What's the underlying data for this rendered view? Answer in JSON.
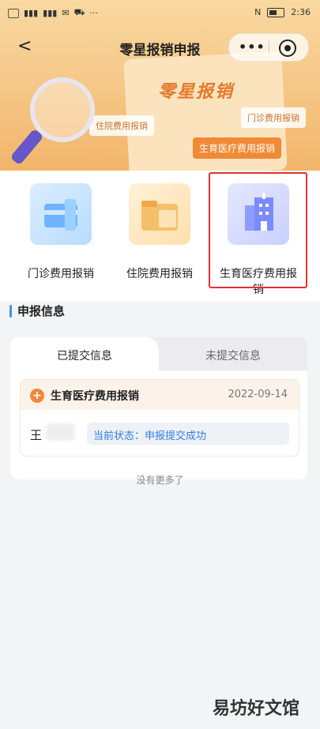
{
  "status_bar": {
    "time": "2:36",
    "left_icons": [
      "hd-icon",
      "signal-icon",
      "signal-icon",
      "app-icon",
      "app-icon",
      "cart-icon",
      "browser-icon"
    ],
    "more_glyph": "···"
  },
  "nav": {
    "back_glyph": "<",
    "title": "零星报销申报",
    "more_glyph": "•••"
  },
  "banner": {
    "title": "零星报销",
    "tags": [
      "住院费用报销",
      "门诊费用报销",
      "生育医疗费用报销"
    ],
    "colors": {
      "top": "#f8d9a0",
      "bottom": "#f2b56a"
    }
  },
  "services": [
    {
      "label": "门诊费用报销",
      "icon": "outpatient-card-icon",
      "color": "#6fb4ff"
    },
    {
      "label": "住院费用报销",
      "icon": "folder-icon",
      "color": "#f5c06a"
    },
    {
      "label": "生育医疗费用报销",
      "icon": "hospital-icon",
      "color": "#7a8bff"
    }
  ],
  "section": {
    "title": "申报信息"
  },
  "tabs": {
    "submitted": "已提交信息",
    "unsubmitted": "未提交信息",
    "active": "submitted"
  },
  "record": {
    "title": "生育医疗费用报销",
    "date": "2022-09-14",
    "person": "王",
    "status": "当前状态：申报提交成功"
  },
  "no_more": "没有更多了",
  "watermark": "易坊好文馆",
  "accent": "#e0322e"
}
